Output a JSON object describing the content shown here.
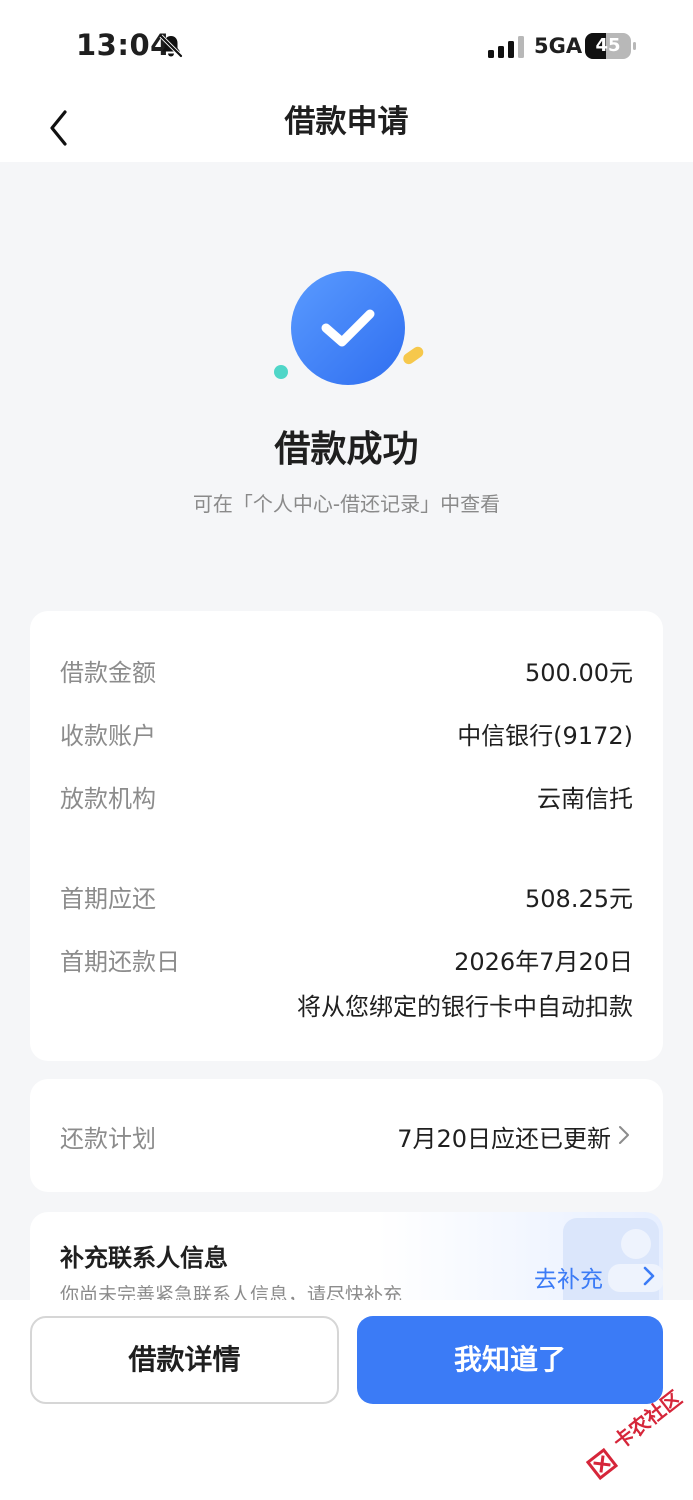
{
  "status_bar": {
    "time": "13:04",
    "network": "5GA",
    "battery_percent": "45",
    "battery_level": 0.45
  },
  "nav": {
    "title": "借款申请"
  },
  "result": {
    "title": "借款成功",
    "subtitle": "可在「个人中心-借还记录」中查看"
  },
  "details": [
    {
      "label": "借款金额",
      "value": "500.00元"
    },
    {
      "label": "收款账户",
      "value": "中信银行(9172)"
    },
    {
      "label": "放款机构",
      "value": "云南信托"
    },
    {
      "label": "首期应还",
      "value": "508.25元"
    },
    {
      "label": "首期还款日",
      "value": "2026年7月20日",
      "note": "将从您绑定的银行卡中自动扣款"
    }
  ],
  "plan": {
    "label": "还款计划",
    "value": "7月20日应还已更新"
  },
  "contact": {
    "title": "补充联系人信息",
    "subtitle": "你尚未完善紧急联系人信息，请尽快补充",
    "action": "去补充"
  },
  "buttons": {
    "secondary": "借款详情",
    "primary": "我知道了"
  },
  "watermark": {
    "text": "卡农社区"
  },
  "colors": {
    "primary": "#3b7bf6",
    "background": "#f5f6f8",
    "label_gray": "#8c8c8c"
  }
}
